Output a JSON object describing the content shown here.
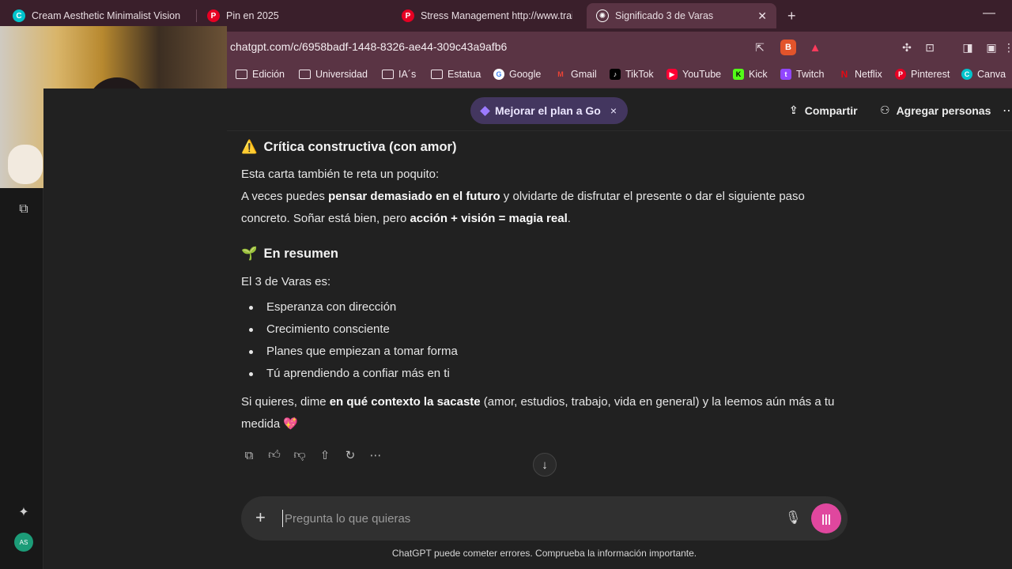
{
  "tabs": [
    {
      "label": "Cream Aesthetic Minimalist Vision Bo",
      "icon": "canva-icon",
      "color": "#00c4cc"
    },
    {
      "label": "Pin en 2025",
      "icon": "pinterest-icon",
      "color": "#e60023"
    },
    {
      "label": "Stress Management http://www.traini",
      "icon": "pinterest-icon",
      "color": "#e60023"
    },
    {
      "label": "Significado 3 de Varas",
      "icon": "chatgpt-icon",
      "color": "#ffffff"
    }
  ],
  "address": {
    "url": "chatgpt.com/c/6958badf-1448-8326-ae44-309c43a9afb6"
  },
  "bookmarks": [
    {
      "label": "Edición",
      "icon": "folder-icon"
    },
    {
      "label": "Universidad",
      "icon": "folder-icon"
    },
    {
      "label": "IA´s",
      "icon": "folder-icon"
    },
    {
      "label": "Estatua",
      "icon": "folder-icon"
    },
    {
      "label": "Google",
      "icon": "google-icon"
    },
    {
      "label": "Gmail",
      "icon": "gmail-icon"
    },
    {
      "label": "TikTok",
      "icon": "tiktok-icon"
    },
    {
      "label": "YouTube",
      "icon": "youtube-icon"
    },
    {
      "label": "Kick",
      "icon": "kick-icon"
    },
    {
      "label": "Twitch",
      "icon": "twitch-icon"
    },
    {
      "label": "Netflix",
      "icon": "netflix-icon"
    },
    {
      "label": "Pinterest",
      "icon": "pinterest-icon"
    },
    {
      "label": "Canva",
      "icon": "canva-icon"
    }
  ],
  "header": {
    "upgrade_label": "Mejorar el plan a Go",
    "upgrade_close": "×",
    "share_label": "Compartir",
    "add_people_label": "Agregar personas"
  },
  "message": {
    "critique_title": "Crítica constructiva (con amor)",
    "critique_emoji": "⚠️",
    "critique_intro": "Esta carta también te reta un poquito:",
    "critique_p1_a": "A veces puedes ",
    "critique_p1_b": "pensar demasiado en el futuro",
    "critique_p1_c": " y olvidarte de disfrutar el presente o dar el siguiente paso concreto. Soñar está bien, pero ",
    "critique_p1_d": "acción + visión = magia real",
    "critique_p1_e": ".",
    "summary_emoji": "🌱",
    "summary_title": "En resumen",
    "summary_intro": "El 3 de Varas es:",
    "bullets": [
      "Esperanza con dirección",
      "Crecimiento consciente",
      "Planes que empiezan a tomar forma",
      "Tú aprendiendo a confiar más en ti"
    ],
    "closing_a": "Si quieres, dime ",
    "closing_b": "en qué contexto la sacaste",
    "closing_c": " (amor, estudios, trabajo, vida en general) y la leemos aún más a tu medida ",
    "closing_emoji": "💖"
  },
  "composer": {
    "placeholder": "Pregunta lo que quieras"
  },
  "footer": {
    "disclaimer": "ChatGPT puede cometer errores. Comprueba la información importante."
  },
  "sidebar": {
    "avatar_initials": "AS"
  },
  "colors": {
    "accent": "#e0479e",
    "upgrade_bg": "#43365f",
    "browser_chrome": "#5a3444"
  }
}
